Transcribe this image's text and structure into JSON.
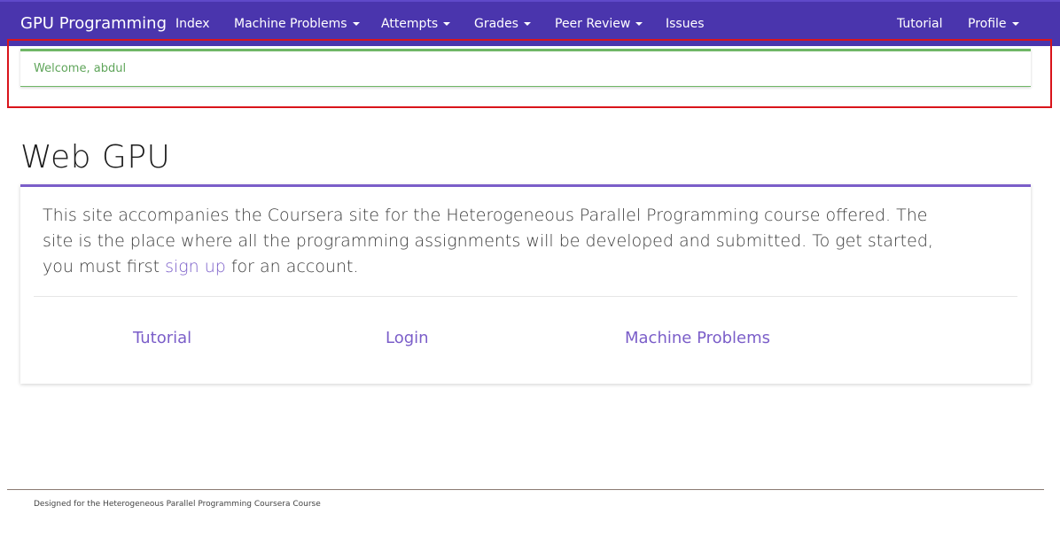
{
  "navbar": {
    "brand": "GPU Programming",
    "items": [
      {
        "label": "Index",
        "dropdown": false
      },
      {
        "label": "Machine Problems",
        "dropdown": true
      },
      {
        "label": "Attempts",
        "dropdown": true
      },
      {
        "label": "Grades",
        "dropdown": true
      },
      {
        "label": "Peer Review",
        "dropdown": true
      },
      {
        "label": "Issues",
        "dropdown": false
      }
    ],
    "right_items": [
      {
        "label": "Tutorial",
        "dropdown": false
      },
      {
        "label": "Profile",
        "dropdown": true
      }
    ]
  },
  "alert": {
    "text": "Welcome, abdul"
  },
  "page": {
    "title": "Web GPU"
  },
  "panel": {
    "text_before": "This site accompanies the Coursera site for the Heterogeneous Parallel Programming course offered. The site is the place where all the programming assignments will be developed and submitted. To get started, you must first ",
    "link": "sign up",
    "text_after": " for an account.",
    "links": [
      "Tutorial",
      "Login",
      "Machine Problems"
    ]
  },
  "footer": {
    "text": "Designed for the Heterogeneous Parallel Programming Coursera Course"
  },
  "colors": {
    "navbar": "#4a35ad",
    "alert_accent": "#6fb766",
    "link": "#7b5ec9",
    "highlight": "#d9141b"
  }
}
